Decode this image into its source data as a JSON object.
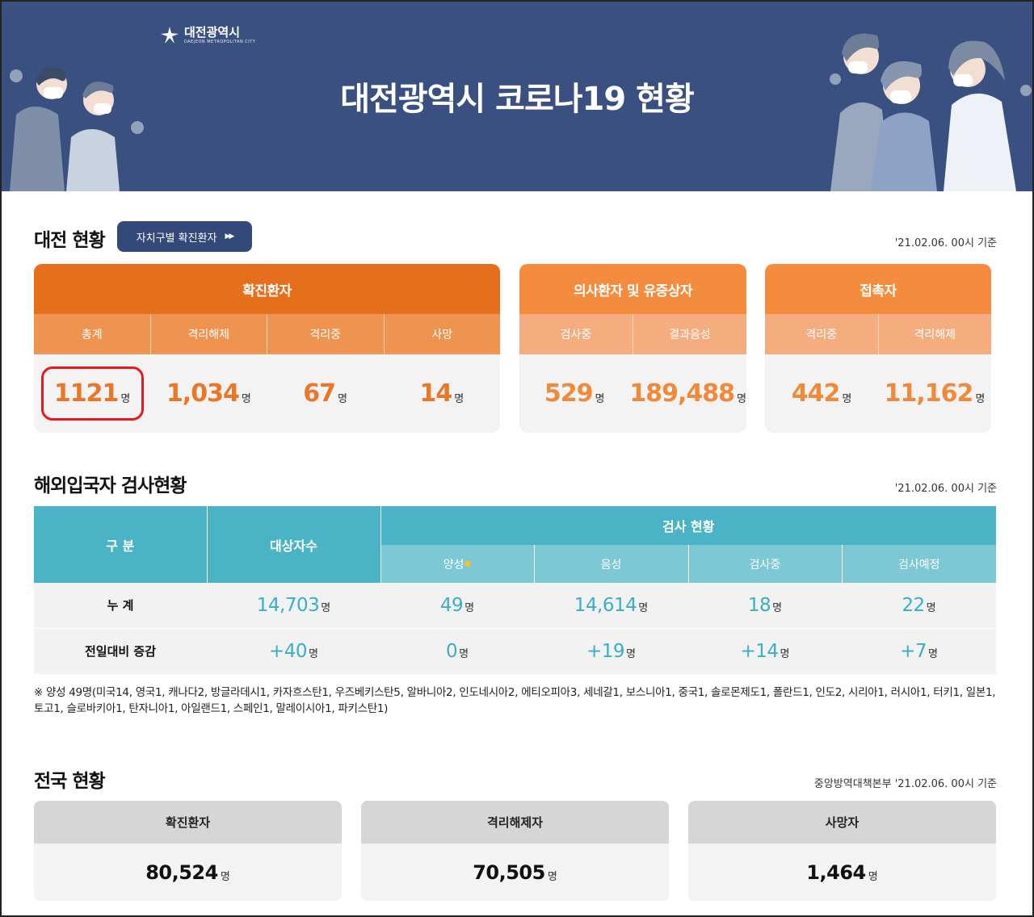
{
  "banner": {
    "logo_text": "대전광역시",
    "logo_sub": "DAEJEON METROPOLITAN CITY",
    "title": "대전광역시 코로나19 현황"
  },
  "daejeon": {
    "section_title": "대전 현황",
    "button_label": "자치구별 확진환자",
    "ref_date": "'21.02.06. 00시 기준",
    "confirmed": {
      "title": "확진환자",
      "cols": [
        "총계",
        "격리해제",
        "격리중",
        "사망"
      ],
      "values": [
        "1121",
        "1,034",
        "67",
        "14"
      ]
    },
    "suspected": {
      "title": "의사환자 및 유증상자",
      "cols": [
        "검사중",
        "결과음성"
      ],
      "values": [
        "529",
        "189,488"
      ]
    },
    "contacts": {
      "title": "접촉자",
      "cols": [
        "격리중",
        "격리해제"
      ],
      "values": [
        "442",
        "11,162"
      ]
    },
    "unit": "명",
    "colors": {
      "deep_orange": "#e56f1c",
      "orange": "#f58b3d",
      "light_orange": "#f5a978",
      "value_orange": "#ea7626"
    }
  },
  "overseas": {
    "section_title": "해외입국자 검사현황",
    "ref_date": "'21.02.06. 00시 기준",
    "head_gubun": "구 분",
    "head_target": "대상자수",
    "head_test": "검사 현황",
    "sub_heads": [
      "양성",
      "음성",
      "검사중",
      "검사예정"
    ],
    "rows": [
      {
        "label": "누 계",
        "values": [
          "14,703",
          "49",
          "14,614",
          "18",
          "22"
        ]
      },
      {
        "label": "전일대비 증감",
        "values": [
          "+40",
          "0",
          "+19",
          "+14",
          "+7"
        ]
      }
    ],
    "unit": "명",
    "note": "※ 양성 49명(미국14, 영국1, 캐나다2, 방글라데시1, 카자흐스탄1, 우즈베키스탄5, 알바니아2, 인도네시아2, 에티오피아3, 세네갈1, 보스니아1, 중국1, 솔로몬제도1, 폴란드1, 인도2, 시리아1, 러시아1, 터키1, 일본1, 토고1, 슬로바키아1, 탄자니아1, 아일랜드1, 스페인1, 말레이시아1, 파키스탄1)",
    "colors": {
      "header": "#4bb3c6",
      "subheader": "#7cc8d5",
      "value": "#3aaec4"
    }
  },
  "national": {
    "section_title": "전국 현황",
    "ref_date": "중앙방역대책본부 '21.02.06. 00시 기준",
    "cards": [
      {
        "title": "확진환자",
        "value": "80,524"
      },
      {
        "title": "격리해제자",
        "value": "70,505"
      },
      {
        "title": "사망자",
        "value": "1,464"
      }
    ],
    "unit": "명"
  }
}
